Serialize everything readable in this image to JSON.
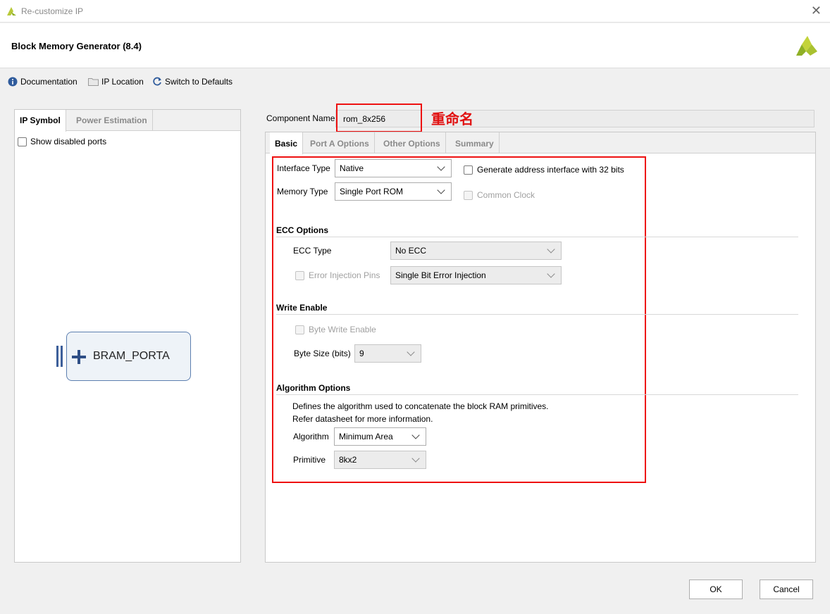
{
  "window": {
    "title": "Re-customize IP",
    "close": "✕"
  },
  "header": {
    "ip_title": "Block Memory Generator (8.4)"
  },
  "toolbar": {
    "documentation": "Documentation",
    "ip_location": "IP Location",
    "switch_defaults": "Switch to Defaults"
  },
  "left": {
    "tabs": [
      "IP Symbol",
      "Power Estimation"
    ],
    "show_disabled_ports": "Show disabled ports",
    "port_label": "BRAM_PORTA"
  },
  "component": {
    "label": "Component Name",
    "value": "rom_8x256",
    "annotation": "重命名"
  },
  "tabs": [
    "Basic",
    "Port A Options",
    "Other Options",
    "Summary"
  ],
  "basic": {
    "interface_type_label": "Interface Type",
    "interface_type_value": "Native",
    "memory_type_label": "Memory Type",
    "memory_type_value": "Single Port ROM",
    "gen_addr_32": "Generate address interface with 32 bits",
    "common_clock": "Common Clock"
  },
  "ecc": {
    "section": "ECC Options",
    "type_label": "ECC Type",
    "type_value": "No ECC",
    "error_injection_label": "Error Injection Pins",
    "error_injection_value": "Single Bit Error Injection"
  },
  "write_enable": {
    "section": "Write Enable",
    "byte_write_enable": "Byte Write Enable",
    "byte_size_label": "Byte Size (bits)",
    "byte_size_value": "9"
  },
  "algorithm": {
    "section": "Algorithm Options",
    "desc1": "Defines the algorithm used to concatenate the block RAM primitives.",
    "desc2": "Refer datasheet for more information.",
    "algorithm_label": "Algorithm",
    "algorithm_value": "Minimum Area",
    "primitive_label": "Primitive",
    "primitive_value": "8kx2"
  },
  "footer": {
    "ok": "OK",
    "cancel": "Cancel"
  },
  "colors": {
    "annotation_red": "#e11111",
    "brand_green": "#8fb026",
    "port_blue": "#3d5f9a"
  }
}
